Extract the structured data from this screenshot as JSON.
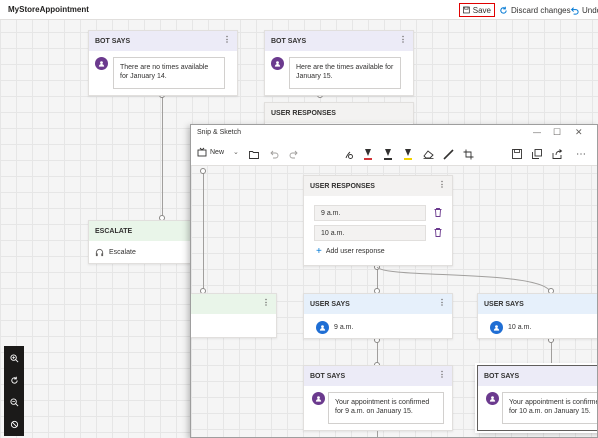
{
  "app": {
    "title": "MyStoreAppointment"
  },
  "toolbar": {
    "save": "Save",
    "discard": "Discard changes",
    "undo": "Undo"
  },
  "canvas": {
    "bot_says_1": {
      "header": "BOT SAYS",
      "message": "There are no times available for January 14."
    },
    "bot_says_2": {
      "header": "BOT SAYS",
      "message": "Here are the times available for January 15."
    },
    "user_responses_bg": {
      "header": "USER RESPONSES"
    },
    "escalate": {
      "header": "ESCALATE",
      "label": "Escalate"
    }
  },
  "snip": {
    "title": "Snip & Sketch",
    "new_label": "New",
    "user_responses": {
      "header": "USER RESPONSES",
      "options": [
        "9 a.m.",
        "10 a.m."
      ],
      "add": "Add user response"
    },
    "user_says_1": {
      "header": "USER SAYS",
      "message": "9 a.m."
    },
    "user_says_2": {
      "header": "USER SAYS",
      "message": "10 a.m."
    },
    "bot_says_1": {
      "header": "BOT SAYS",
      "message": "Your appointment is confirmed for 9 a.m. on January 15."
    },
    "bot_says_2": {
      "header": "BOT SAYS",
      "message": "Your appointment is confirmed for 10 a.m. on January 15."
    }
  },
  "colors": {
    "accent": "#6b3a8e",
    "save_highlight": "#e00000",
    "user_blue": "#1f6ed4"
  }
}
